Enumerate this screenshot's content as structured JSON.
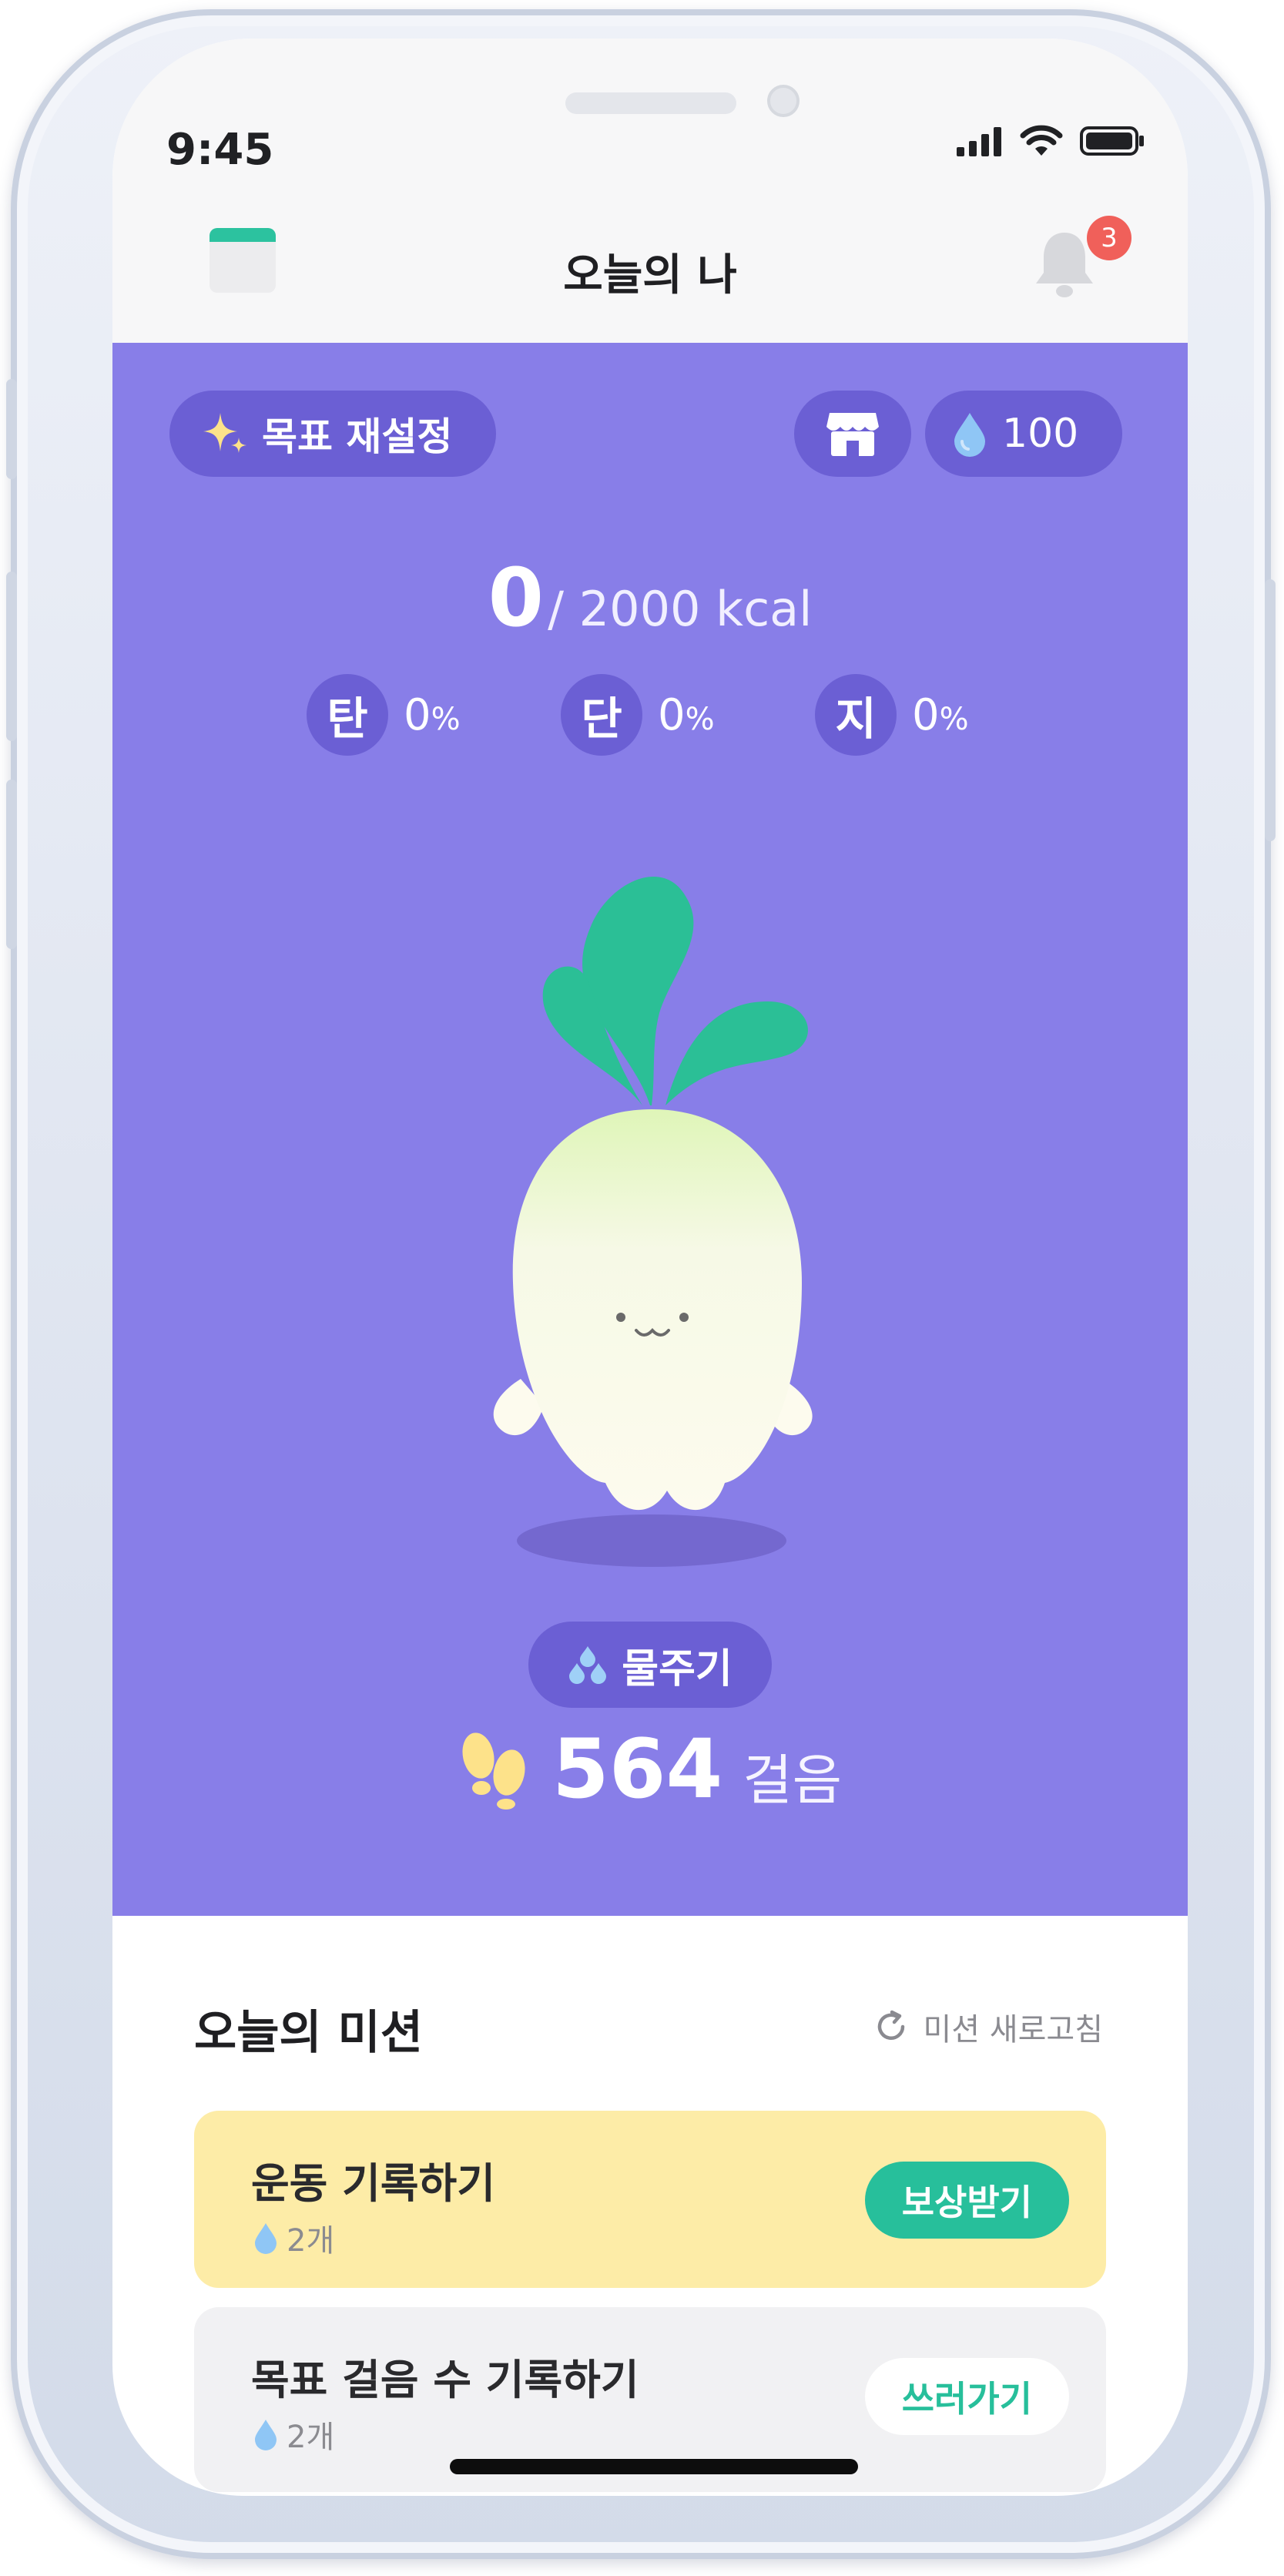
{
  "status_bar": {
    "time": "9:45"
  },
  "header": {
    "title": "오늘의 나",
    "notification_count": "3",
    "left_icon": "calendar-icon",
    "right_icon": "bell-icon"
  },
  "hero": {
    "background": "#887ee8",
    "goal_reset_label": "목표 재설정",
    "water_balance": "100",
    "calories_current": "0",
    "calories_goal": "/ 2000 kcal",
    "macros": [
      {
        "name": "탄",
        "value": "0",
        "unit": "%"
      },
      {
        "name": "단",
        "value": "0",
        "unit": "%"
      },
      {
        "name": "지",
        "value": "0",
        "unit": "%"
      }
    ],
    "water_button_label": "물주기",
    "steps_value": "564",
    "steps_unit": "걸음"
  },
  "missions": {
    "title": "오늘의 미션",
    "refresh_label": "미션 새로고침",
    "items": [
      {
        "label": "운동 기록하기",
        "reward": "2개",
        "action": "보상받기"
      },
      {
        "label": "목표 걸음 수 기록하기",
        "reward": "2개",
        "action": "쓰러가기"
      }
    ]
  },
  "colors": {
    "accent_green": "#27bf9b",
    "pill_purple": "#6b5fd4",
    "mission_yellow": "#fdeca7",
    "badge_red": "#f0605a"
  }
}
